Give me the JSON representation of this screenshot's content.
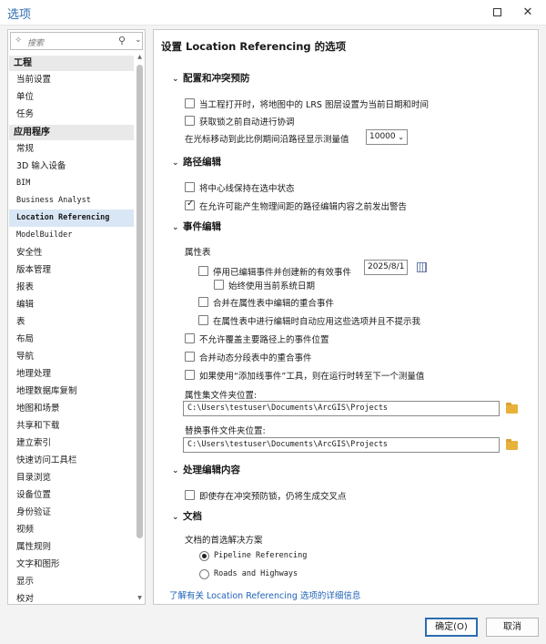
{
  "window": {
    "title": "选项"
  },
  "search": {
    "placeholder": "搜索"
  },
  "nav": {
    "group1": "工程",
    "group1_items": [
      "当前设置",
      "单位",
      "任务"
    ],
    "group2": "应用程序",
    "group2_items": [
      "常规",
      "3D 输入设备",
      "BIM",
      "Business Analyst",
      "Location Referencing",
      "ModelBuilder",
      "安全性",
      "版本管理",
      "报表",
      "编辑",
      "表",
      "布局",
      "导航",
      "地理处理",
      "地理数据库复制",
      "地图和场景",
      "共享和下载",
      "建立索引",
      "快速访问工具栏",
      "目录浏览",
      "设备位置",
      "身份验证",
      "视频",
      "属性规则",
      "文字和图形",
      "显示",
      "校对"
    ],
    "selected": "Location Referencing"
  },
  "panel": {
    "title": "设置 Location Referencing 的选项",
    "config": {
      "header": "配置和冲突预防",
      "opt1": "当工程打开时，将地图中的 LRS 图层设置为当前日期和时间",
      "opt2": "获取锁之前自动进行协调",
      "scale_label": "在光标移动到此比例期间沿路径显示测量值",
      "scale_value": "10000"
    },
    "route": {
      "header": "路径编辑",
      "opt1": "将中心线保持在选中状态",
      "opt2": "在允许可能产生物理间距的路径编辑内容之前发出警告"
    },
    "event": {
      "header": "事件编辑",
      "attr_table": "属性表",
      "opt_retire": "停用已编辑事件并创建新的有效事件",
      "date_value": "2025/8/1",
      "opt_always_date": "始终使用当前系统日期",
      "opt_merge_table": "合并在属性表中编辑的重合事件",
      "opt_apply_no_prompt": "在属性表中进行编辑时自动应用这些选项并且不提示我",
      "opt_no_overlay": "不允许覆盖主要路径上的事件位置",
      "opt_merge_dynseg": "合并动态分段表中的重合事件",
      "opt_add_line": "如果使用“添加线事件”工具，则在运行时转至下一个测量值",
      "attr_folder_label": "属性集文件夹位置:",
      "attr_folder_path": "C:\\Users\\testuser\\Documents\\ArcGIS\\Projects",
      "replace_folder_label": "替换事件文件夹位置:",
      "replace_folder_path": "C:\\Users\\testuser\\Documents\\ArcGIS\\Projects"
    },
    "handle": {
      "header": "处理编辑内容",
      "opt1": "即使存在冲突预防锁，仍将生成交叉点"
    },
    "docs": {
      "header": "文档",
      "pref_label": "文档的首选解决方案",
      "radio1": "Pipeline Referencing",
      "radio2": "Roads and Highways"
    },
    "more_link": "了解有关 Location Referencing 选项的详细信息"
  },
  "footer": {
    "ok": "确定(O)",
    "cancel": "取消"
  },
  "state": {
    "config_opt1": false,
    "config_opt2": false,
    "route_opt1": false,
    "route_opt2": true,
    "event_retire": false,
    "event_always_date": false,
    "event_merge_table": false,
    "event_apply_no_prompt": false,
    "event_no_overlay": false,
    "event_merge_dynseg": false,
    "event_add_line": false,
    "handle_opt1": false,
    "docs_selected": "Pipeline Referencing"
  }
}
